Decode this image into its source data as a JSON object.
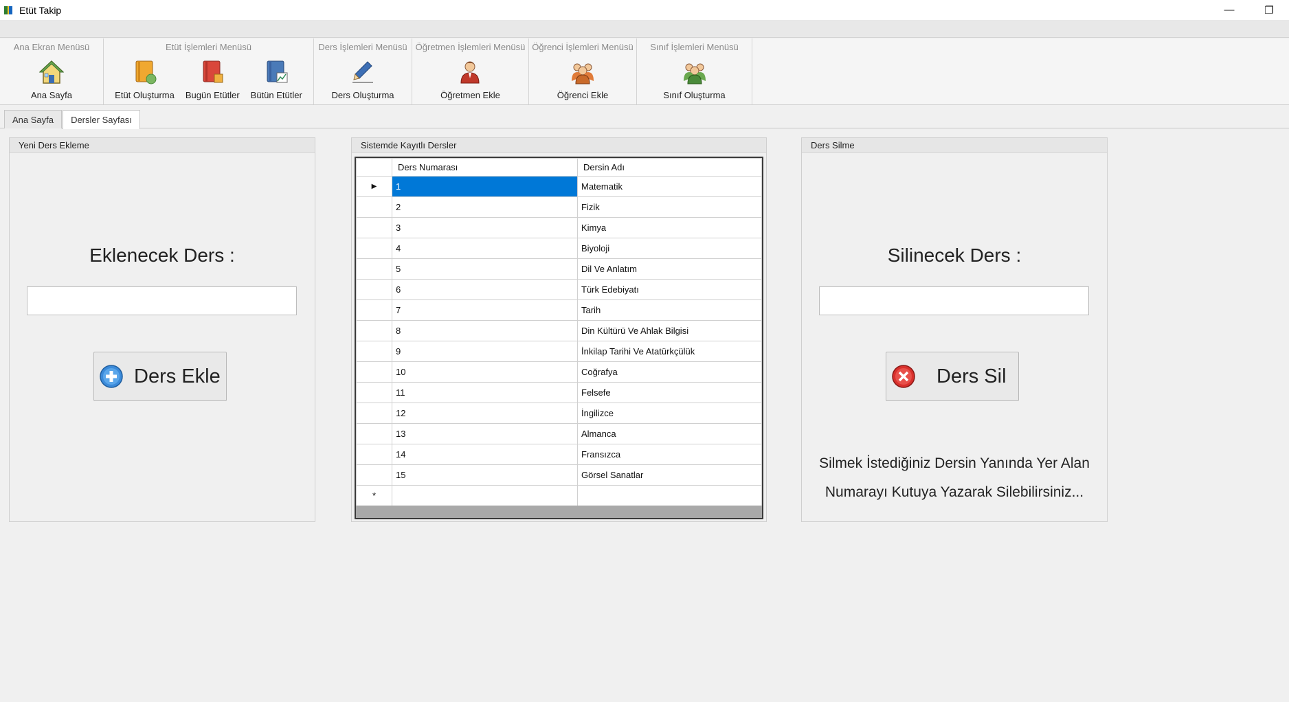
{
  "window": {
    "title": "Etüt Takip",
    "minimize": "—",
    "restore": "❐"
  },
  "ribbon": {
    "groups": [
      {
        "title": "Ana Ekran Menüsü",
        "items": [
          {
            "label": "Ana Sayfa",
            "icon": "home-icon"
          }
        ]
      },
      {
        "title": "Etüt İşlemleri Menüsü",
        "items": [
          {
            "label": "Etüt Oluşturma",
            "icon": "etut-create-icon"
          },
          {
            "label": "Bugün Etütler",
            "icon": "today-etut-icon"
          },
          {
            "label": "Bütün Etütler",
            "icon": "all-etut-icon"
          }
        ]
      },
      {
        "title": "Ders İşlemleri Menüsü",
        "items": [
          {
            "label": "Ders Oluşturma",
            "icon": "pencil-icon"
          }
        ]
      },
      {
        "title": "Öğretmen İşlemleri Menüsü",
        "items": [
          {
            "label": "Öğretmen Ekle",
            "icon": "teacher-icon"
          }
        ]
      },
      {
        "title": "Öğrenci İşlemleri Menüsü",
        "items": [
          {
            "label": "Öğrenci Ekle",
            "icon": "students-icon"
          }
        ]
      },
      {
        "title": "Sınıf İşlemleri Menüsü",
        "items": [
          {
            "label": "Sınıf Oluşturma",
            "icon": "classroom-icon"
          }
        ]
      }
    ]
  },
  "tabs": [
    {
      "label": "Ana Sayfa",
      "active": false
    },
    {
      "label": "Dersler Sayfası",
      "active": true
    }
  ],
  "add_panel": {
    "title": "Yeni Ders Ekleme",
    "label": "Eklenecek Ders :",
    "input_value": "",
    "button": "Ders Ekle"
  },
  "list_panel": {
    "title": "Sistemde Kayıtlı Dersler",
    "columns": [
      "Ders Numarası",
      "Dersin Adı"
    ],
    "rows": [
      [
        "1",
        "Matematik"
      ],
      [
        "2",
        "Fizik"
      ],
      [
        "3",
        "Kimya"
      ],
      [
        "4",
        "Biyoloji"
      ],
      [
        "5",
        "Dil Ve Anlatım"
      ],
      [
        "6",
        "Türk Edebiyatı"
      ],
      [
        "7",
        "Tarih"
      ],
      [
        "8",
        "Din Kültürü Ve Ahlak Bilgisi"
      ],
      [
        "9",
        "İnkilap Tarihi Ve Atatürkçülük"
      ],
      [
        "10",
        "Coğrafya"
      ],
      [
        "11",
        "Felsefe"
      ],
      [
        "12",
        "İngilizce"
      ],
      [
        "13",
        "Almanca"
      ],
      [
        "14",
        "Fransızca"
      ],
      [
        "15",
        "Görsel Sanatlar"
      ]
    ],
    "selected_row": 0,
    "current_marker": "▶",
    "new_row_marker": "*"
  },
  "delete_panel": {
    "title": "Ders Silme",
    "label": "Silinecek Ders :",
    "input_value": "",
    "button": "Ders Sil",
    "info_line1": "Silmek İstediğiniz Dersin Yanında Yer Alan",
    "info_line2": "Numarayı Kutuya Yazarak Silebilirsiniz..."
  },
  "colors": {
    "selection": "#0078d7",
    "add_icon": "#3b8ad9",
    "delete_icon": "#d9302c"
  }
}
